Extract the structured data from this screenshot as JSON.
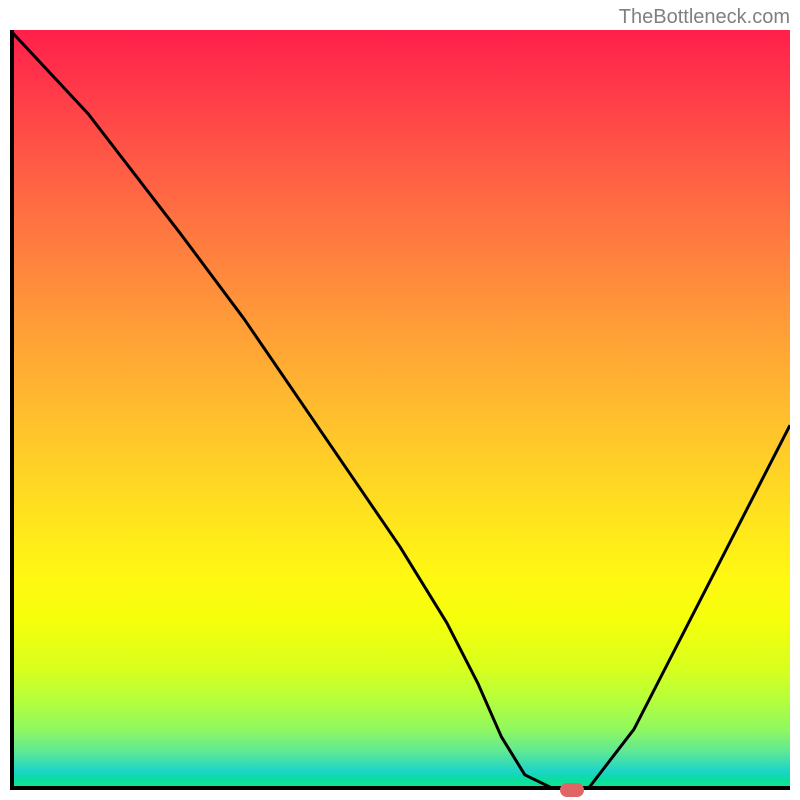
{
  "watermark": "TheBottleneck.com",
  "chart_data": {
    "type": "line",
    "title": "",
    "xlabel": "",
    "ylabel": "",
    "xlim": [
      0,
      100
    ],
    "ylim": [
      0,
      100
    ],
    "series": [
      {
        "name": "curve",
        "x": [
          0,
          10,
          22,
          30,
          40,
          50,
          56,
          60,
          63,
          66,
          70,
          74,
          80,
          86,
          92,
          100
        ],
        "values": [
          100,
          89,
          73,
          62,
          47,
          32,
          22,
          14,
          7,
          2,
          0,
          0,
          8,
          20,
          32,
          48
        ]
      }
    ],
    "marker": {
      "x": 72,
      "y": 0
    },
    "background": "heat-gradient"
  }
}
